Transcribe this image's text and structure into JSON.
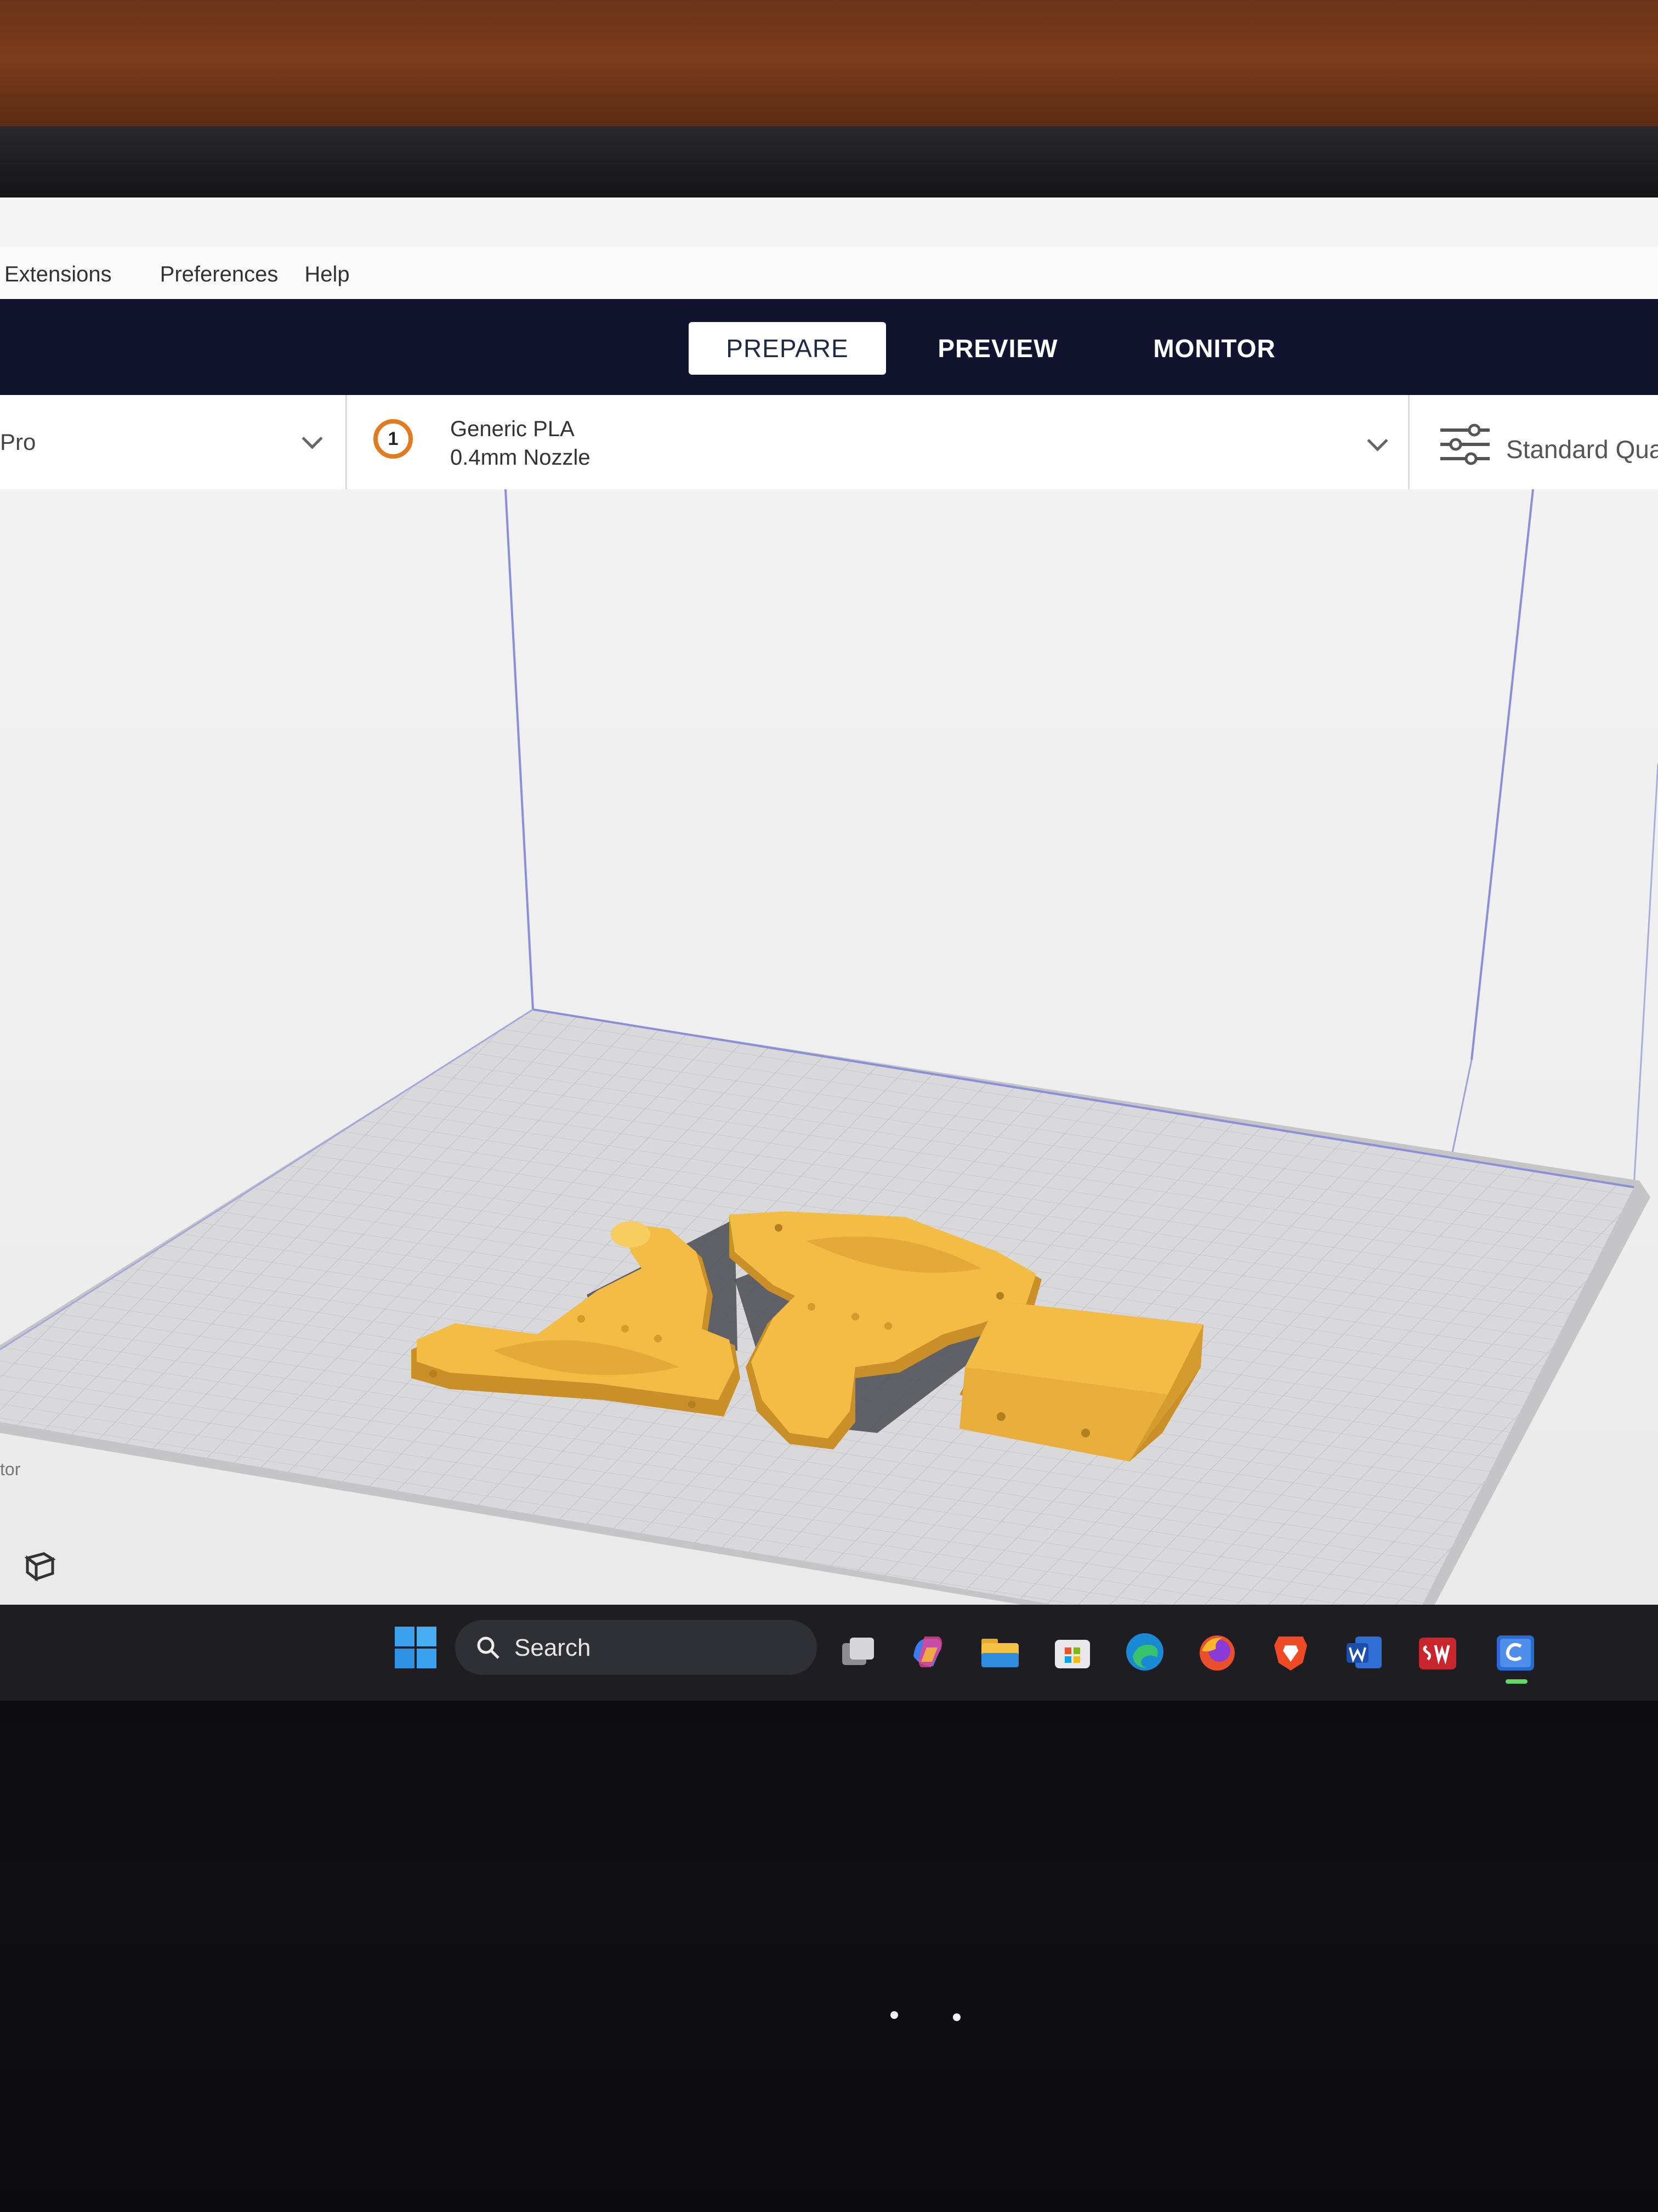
{
  "menu": {
    "items": [
      "Extensions",
      "Preferences",
      "Help"
    ]
  },
  "stages": {
    "prepare": "PREPARE",
    "preview": "PREVIEW",
    "monitor": "MONITOR",
    "active": "PREPARE"
  },
  "printer": {
    "name": "Pro"
  },
  "material": {
    "extruder_number": "1",
    "name": "Generic PLA",
    "nozzle": "0.4mm Nozzle"
  },
  "quality": {
    "label": "Standard Qua"
  },
  "viewport": {
    "partial_label": "tor",
    "model_color": "#f3bd45",
    "model_shadow_color": "#c9902a",
    "build_plate_color": "#d9d9d9"
  },
  "taskbar": {
    "search_label": "Search",
    "apps": [
      "task-view-icon",
      "copilot-icon",
      "file-explorer-icon",
      "microsoft-store-icon",
      "edge-icon",
      "firefox-icon",
      "brave-icon",
      "word-icon",
      "solidworks-icon",
      "cura-icon"
    ]
  },
  "colors": {
    "stage_bar": "#12132e",
    "extruder_ring": "#e07b1f"
  }
}
